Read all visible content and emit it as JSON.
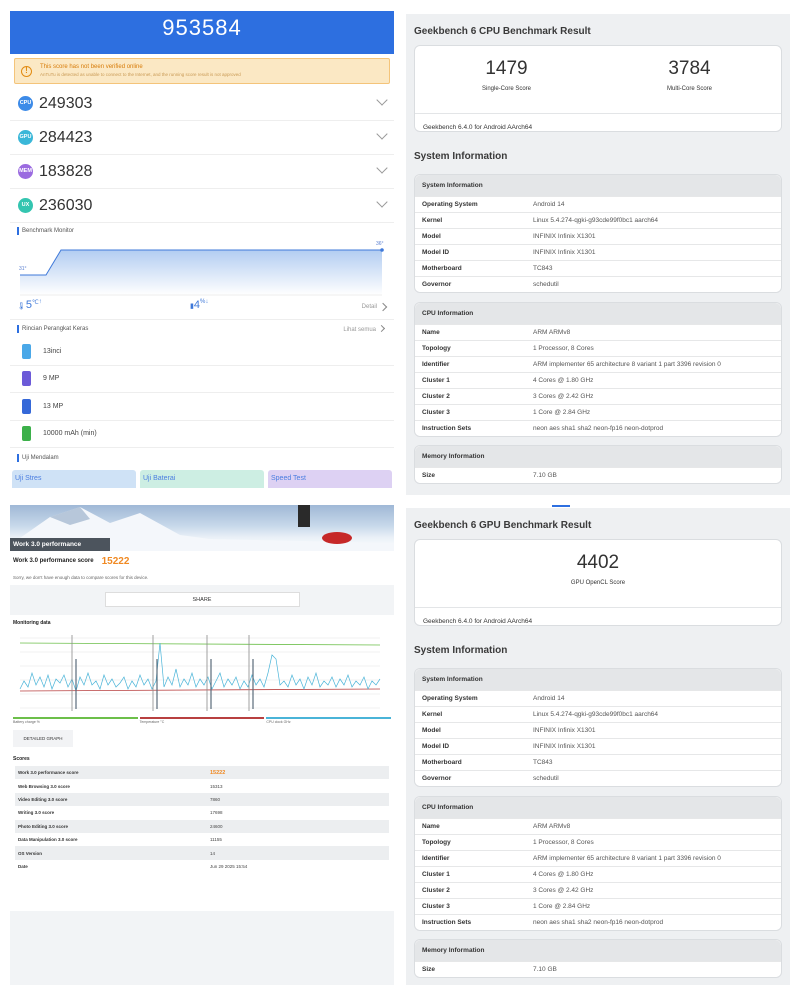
{
  "antutu": {
    "total_score": "953584",
    "warning": {
      "title": "This score has not been verified online",
      "detail": "AnTuTu is detected as unable to connect to the Internet, and the running score result is not approved"
    },
    "sub_scores": [
      {
        "badge": "CPU",
        "value": "249303",
        "color": "#3d8be8"
      },
      {
        "badge": "GPU",
        "value": "284423",
        "color": "#3ab7d8"
      },
      {
        "badge": "MEM",
        "value": "183828",
        "color": "#9b6be0"
      },
      {
        "badge": "UX",
        "value": "236030",
        "color": "#34c5b0"
      }
    ],
    "benchmark_monitor_label": "Benchmark Monitor",
    "monitor": {
      "start_temp": "31°",
      "end_temp": "36°",
      "temp_rise": "5",
      "temp_unit": "℃",
      "battery_drop": "4",
      "battery_unit": "%",
      "detail_label": "Detail"
    },
    "hardware_label": "Rincian Perangkat Keras",
    "see_all_label": "Lihat semua",
    "hardware_items": [
      {
        "text": "13inci",
        "icon": "screen-icon",
        "color": "#4aa8e8"
      },
      {
        "text": "9 MP",
        "icon": "front-camera-icon",
        "color": "#6c5ad8"
      },
      {
        "text": "13 MP",
        "icon": "rear-camera-icon",
        "color": "#3568d8"
      },
      {
        "text": "10000 mAh (min)",
        "icon": "battery-icon",
        "color": "#3cb04a"
      }
    ],
    "deep_test_label": "Uji Mendalam",
    "tiles": [
      {
        "label": "Uji Stres",
        "bg": "#cfe2f6"
      },
      {
        "label": "Uji Baterai",
        "bg": "#cdeee3"
      },
      {
        "label": "Speed Test",
        "bg": "#ddd1f3"
      }
    ]
  },
  "pcmark": {
    "hero_label": "Work 3.0 performance",
    "score_label": "Work 3.0 performance score",
    "score_value": "15222",
    "compare_note": "Sorry, we don't have enough data to compare scores for this device.",
    "share_label": "SHARE",
    "monitoring_label": "Monitoring data",
    "legend": [
      "Battery charge %",
      "Temperature °C",
      "CPU clock GHz"
    ],
    "detailed_graph_label": "DETAILED GRAPH",
    "scores_label": "Scores",
    "scores_table": [
      {
        "name": "Work 3.0 performance score",
        "value": "15222"
      },
      {
        "name": "Web Browsing 3.0 score",
        "value": "15313"
      },
      {
        "name": "Video Editing 3.0 score",
        "value": "7860"
      },
      {
        "name": "Writing 3.0 score",
        "value": "17698"
      },
      {
        "name": "Photo Editing 3.0 score",
        "value": "24600"
      },
      {
        "name": "Data Manipulation 3.0 score",
        "value": "11155"
      },
      {
        "name": "OS Version",
        "value": "14"
      },
      {
        "name": "Date",
        "value": "Jun 29 2025 15:54"
      }
    ]
  },
  "gb_cpu": {
    "title": "Geekbench 6 CPU Benchmark Result",
    "single_core_score": "1479",
    "single_core_label": "Single-Core Score",
    "multi_core_score": "3784",
    "multi_core_label": "Multi-Core Score",
    "version": "Geekbench 6.4.0 for Android AArch64"
  },
  "gb_gpu": {
    "title": "Geekbench 6 GPU Benchmark Result",
    "score": "4402",
    "score_label": "GPU OpenCL Score",
    "version": "Geekbench 6.4.0 for Android AArch64"
  },
  "system_info_title": "System Information",
  "system_information": {
    "header": "System Information",
    "rows": [
      {
        "key": "Operating System",
        "value": "Android 14"
      },
      {
        "key": "Kernel",
        "value": "Linux 5.4.274-qgki-g93cde99f0bc1 aarch64"
      },
      {
        "key": "Model",
        "value": "INFINIX Infinix X1301"
      },
      {
        "key": "Model ID",
        "value": "INFINIX Infinix X1301"
      },
      {
        "key": "Motherboard",
        "value": "TC843"
      },
      {
        "key": "Governor",
        "value": "schedutil"
      }
    ]
  },
  "cpu_information": {
    "header": "CPU Information",
    "rows": [
      {
        "key": "Name",
        "value": "ARM ARMv8"
      },
      {
        "key": "Topology",
        "value": "1 Processor, 8 Cores"
      },
      {
        "key": "Identifier",
        "value": "ARM implementer 65 architecture 8 variant 1 part 3396 revision 0"
      },
      {
        "key": "Cluster 1",
        "value": "4 Cores @ 1.80 GHz"
      },
      {
        "key": "Cluster 2",
        "value": "3 Cores @ 2.42 GHz"
      },
      {
        "key": "Cluster 3",
        "value": "1 Core @ 2.84 GHz"
      },
      {
        "key": "Instruction Sets",
        "value": "neon aes sha1 sha2 neon-fp16 neon-dotprod"
      }
    ]
  },
  "memory_information": {
    "header": "Memory Information",
    "rows": [
      {
        "key": "Size",
        "value": "7.10 GB"
      }
    ]
  }
}
